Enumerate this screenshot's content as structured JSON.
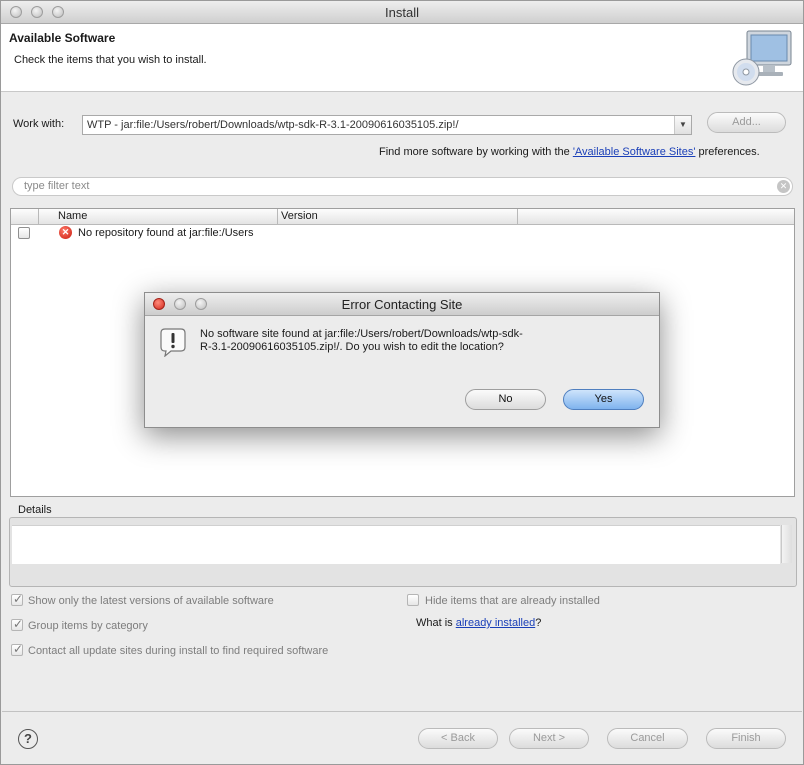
{
  "window": {
    "title": "Install"
  },
  "banner": {
    "title": "Available Software",
    "subtitle": "Check the items that you wish to install."
  },
  "work_with": {
    "label": "Work with:",
    "value": "WTP - jar:file:/Users/robert/Downloads/wtp-sdk-R-3.1-20090616035105.zip!/",
    "add_label": "Add...",
    "find_more_prefix": "Find more software by working with the ",
    "find_more_link": "'Available Software Sites'",
    "find_more_suffix": " preferences."
  },
  "filter": {
    "placeholder": "type filter text"
  },
  "table": {
    "columns": [
      "Name",
      "Version"
    ],
    "rows": [
      {
        "name": "No repository found at jar:file:/Users",
        "version": "",
        "checked": false,
        "status": "error"
      }
    ]
  },
  "details": {
    "label": "Details"
  },
  "options": {
    "latest": {
      "label": "Show only the latest versions of available software",
      "checked": true
    },
    "group": {
      "label": "Group items by category",
      "checked": true
    },
    "contact": {
      "label": "Contact all update sites during install to find required software",
      "checked": true
    },
    "hide": {
      "label": "Hide items that are already installed",
      "checked": false
    },
    "what_prefix": "What is ",
    "what_link": "already installed",
    "what_suffix": "?"
  },
  "footer": {
    "back": "< Back",
    "next": "Next >",
    "cancel": "Cancel",
    "finish": "Finish",
    "help": "?"
  },
  "dialog": {
    "title": "Error Contacting Site",
    "message_line1": "No software site found at jar:file:/Users/robert/Downloads/wtp-sdk-",
    "message_line2": "R-3.1-20090616035105.zip!/.  Do you wish to edit the location?",
    "no": "No",
    "yes": "Yes"
  },
  "colors": {
    "link": "#1a3fb8",
    "default_button": "#7fb3ee",
    "error": "#c91a0e"
  }
}
